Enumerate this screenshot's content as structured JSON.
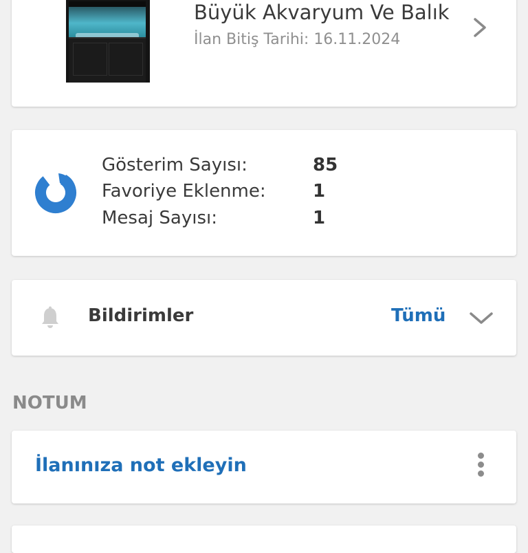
{
  "listing": {
    "title": "Büyük Akvaryum Ve Balık",
    "end_date_text": "İlan Bitiş Tarihi: 16.11.2024",
    "image_icon": "aquarium-photo",
    "chevron_icon": "chevron-right-icon"
  },
  "stats": {
    "icon": "pie-chart-icon",
    "rows": [
      {
        "label": "Gösterim Sayısı:",
        "value": "85"
      },
      {
        "label": "Favoriye Eklenme:",
        "value": "1"
      },
      {
        "label": "Mesaj Sayısı:",
        "value": "1"
      }
    ]
  },
  "notifications": {
    "icon": "bell-icon",
    "title": "Bildirimler",
    "all_label": "Tümü",
    "toggle_icon": "chevron-down-icon"
  },
  "note_section": {
    "header": "NOTUM",
    "add_note_label": "İlanınıza not ekleyin",
    "menu_icon": "kebab-menu-icon"
  },
  "colors": {
    "background": "#f1f1f1",
    "card": "#ffffff",
    "accent_blue": "#1f6fb8",
    "icon_blue": "#2f7fd0",
    "text_dark": "#3a3a3a",
    "text_muted": "#8f8f8f"
  }
}
